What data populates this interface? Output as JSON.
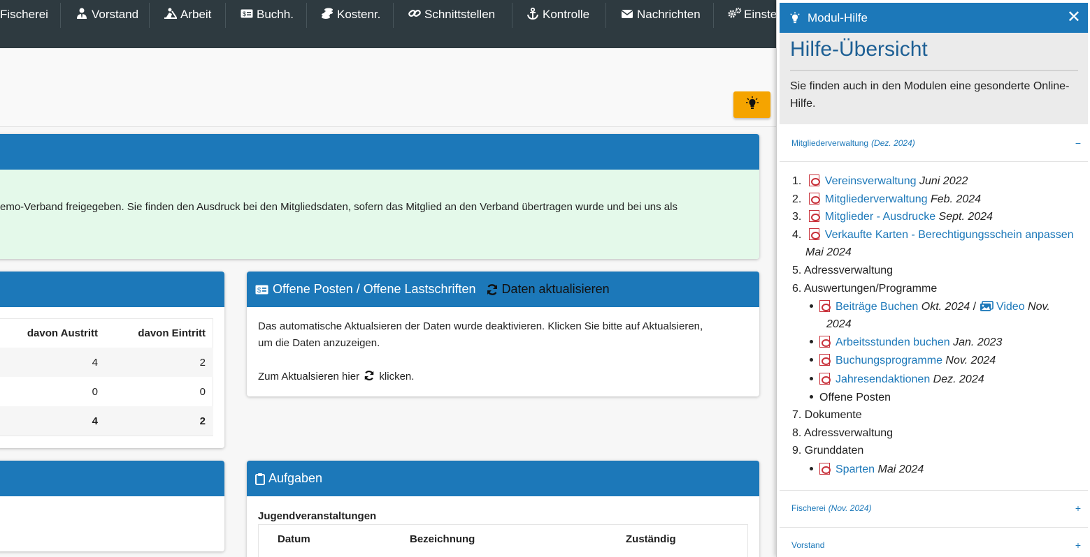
{
  "nav": {
    "items": [
      {
        "label": "Fischerei",
        "icon": ""
      },
      {
        "label": "Vorstand",
        "icon": "user-tie-icon"
      },
      {
        "label": "Arbeit",
        "icon": "digging-icon"
      },
      {
        "label": "Buchh.",
        "icon": "money-check-icon"
      },
      {
        "label": "Kostenr.",
        "icon": "coins-icon"
      },
      {
        "label": "Schnittstellen",
        "icon": "link-icon"
      },
      {
        "label": "Kontrolle",
        "icon": "anchor-icon"
      },
      {
        "label": "Nachrichten",
        "icon": "envelope-icon"
      },
      {
        "label": "Einste",
        "icon": "cogs-icon"
      }
    ]
  },
  "notice": {
    "text": "emo-Verband freigegeben. Sie finden den Ausdruck bei den Mitgliedsdaten, sofern das Mitglied an den Verband übertragen wurde und bei uns als"
  },
  "stats": {
    "headers": [
      "davon Austritt",
      "davon Eintritt"
    ],
    "rows": [
      [
        "4",
        "2"
      ],
      [
        "0",
        "0"
      ],
      [
        "4",
        "2"
      ]
    ]
  },
  "offene_posten": {
    "title": "Offene Posten / Offene Lastschriften",
    "refresh_label": "Daten aktualisieren",
    "text1": "Das automatische Aktualsieren der Daten wurde deaktivieren. Klicken Sie bitte auf Aktualsieren,",
    "text2": "um die Daten anzuzeigen.",
    "text3a": "Zum Aktualsieren hier",
    "text3b": "klicken."
  },
  "aufgaben": {
    "title": "Aufgaben",
    "subtitle": "Jugendveranstaltungen",
    "columns": [
      "Datum",
      "Bezeichnung",
      "Zuständig"
    ]
  },
  "help": {
    "header": "Modul-Hilfe",
    "close": "✕",
    "title": "Hilfe-Übersicht",
    "intro_line1": "Sie finden auch in den Modulen eine gesonderte Online-",
    "intro_line2": "Hilfe.",
    "sections": [
      {
        "name": "Mitgliederverwaltung",
        "date": "(Dez. 2024)",
        "toggle": "−"
      },
      {
        "name": "Fischerei",
        "date": "(Nov. 2024)",
        "toggle": "+"
      },
      {
        "name": "Vorstand",
        "date": "",
        "toggle": "+"
      }
    ],
    "list": {
      "n1": "1.",
      "l1": "Vereinsverwaltung",
      "d1": "Juni 2022",
      "n2": "2.",
      "l2": "Mitgliederverwaltung",
      "d2": "Feb. 2024",
      "n3": "3.",
      "l3": "Mitglieder - Ausdrucke",
      "d3": "Sept. 2024",
      "n4": "4.",
      "l4": "Verkaufte Karten - Berechtigungsschein anpassen",
      "d4": "Mai 2024",
      "n5": "5.",
      "t5": "Adressverwaltung",
      "n6": "6.",
      "t6": "Auswertungen/Programme",
      "s1": "Beiträge Buchen",
      "s1d": "Okt. 2024",
      "s1sep": "/",
      "s1v": "Video",
      "s1vd1": "Nov.",
      "s1vd2": "2024",
      "s2": "Arbeitsstunden buchen",
      "s2d": "Jan. 2023",
      "s3": "Buchungsprogramme",
      "s3d": "Nov. 2024",
      "s4": "Jahresendaktionen",
      "s4d": "Dez. 2024",
      "s5": "Offene Posten",
      "n7": "7.",
      "t7": "Dokumente",
      "n8": "8.",
      "t8": "Adressverwaltung",
      "n9": "9.",
      "t9": "Grunddaten",
      "s6": "Sparten",
      "s6d": "Mai 2024"
    }
  }
}
